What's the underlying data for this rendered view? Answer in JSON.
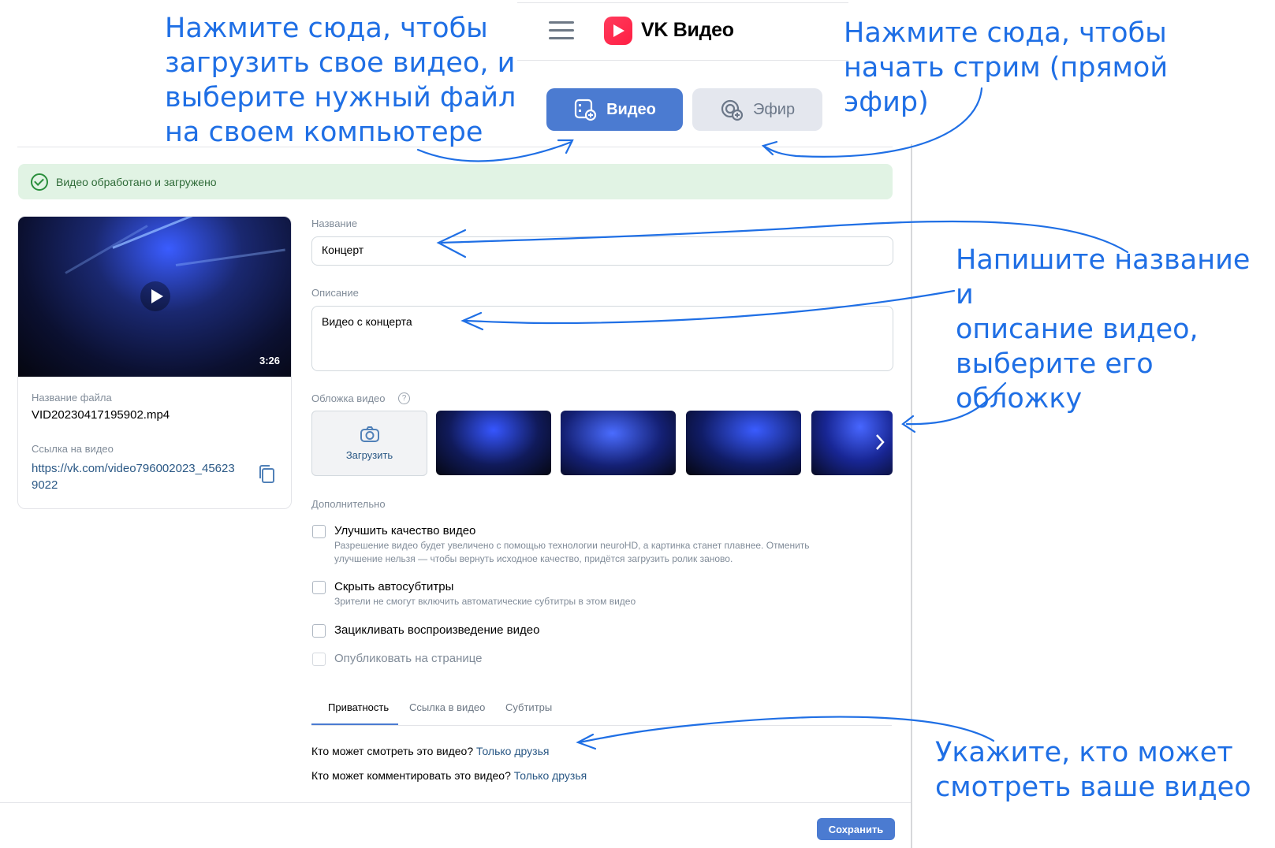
{
  "header": {
    "brand": "VK Видео",
    "tab_video": "Видео",
    "tab_live": "Эфир"
  },
  "status": {
    "success_text": "Видео обработано и загружено"
  },
  "video": {
    "duration": "3:26",
    "file_name_label": "Название файла",
    "file_name": "VID20230417195902.mp4",
    "link_label": "Ссылка на видео",
    "link_line1": "https://vk.com/video796002023_45623",
    "link_line2": "9022"
  },
  "form": {
    "title_label": "Название",
    "title_value": "Концерт",
    "desc_label": "Описание",
    "desc_value": "Видео с концерта",
    "cover_label": "Обложка видео",
    "cover_upload": "Загрузить",
    "extra_label": "Дополнительно",
    "options": [
      {
        "title": "Улучшить качество видео",
        "desc1": "Разрешение видео будет увеличено с помощью технологии neuroHD, а картинка станет плавнее. Отменить",
        "desc2": "улучшение нельзя — чтобы вернуть исходное качество, придётся загрузить ролик заново."
      },
      {
        "title": "Скрыть автосубтитры",
        "desc1": "Зрители не смогут включить автоматические субтитры в этом видео",
        "desc2": ""
      },
      {
        "title": "Зацикливать воспроизведение видео",
        "desc1": "",
        "desc2": ""
      },
      {
        "title": "Опубликовать на странице",
        "desc1": "",
        "desc2": ""
      }
    ],
    "tabs": [
      "Приватность",
      "Ссылка в видео",
      "Субтитры"
    ],
    "privacy_view_q": "Кто может смотреть это видео?",
    "privacy_view_a": "Только друзья",
    "privacy_comment_q": "Кто может комментировать это видео?",
    "privacy_comment_a": "Только друзья",
    "save": "Сохранить"
  },
  "annotations": {
    "upload": [
      "Нажмите сюда, чтобы",
      "загрузить свое видео, и",
      "выберите нужный файл",
      "на своем компьютере"
    ],
    "stream": [
      "Нажмите сюда, чтобы",
      "начать стрим (прямой",
      "эфир)"
    ],
    "describe": [
      "Напишите название и",
      "описание видео,",
      "выберите его",
      "обложку"
    ],
    "privacy": [
      "Укажите, кто может",
      "смотреть ваше видео"
    ]
  },
  "colors": {
    "accent": "#4b7bd1",
    "annotation": "#1f6fe5",
    "success_bg": "#e1f3e4",
    "link": "#2a5885"
  }
}
